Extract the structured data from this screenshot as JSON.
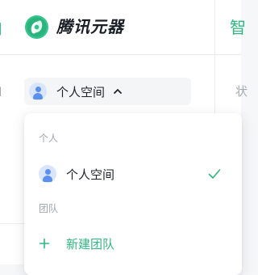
{
  "brand": {
    "name": "腾讯元器",
    "accent_color": "#2fb780",
    "logo_icon": "yuanqi-logo-icon"
  },
  "right_panel": {
    "title_fragment": "智",
    "sub_fragment": "状"
  },
  "workspace_switcher": {
    "current": "个人空间",
    "avatar_icon": "user-avatar-icon",
    "chevron_icon": "chevron-up-icon"
  },
  "dropdown": {
    "personal_section_label": "个人",
    "personal_item_label": "个人空间",
    "personal_item_selected": true,
    "check_icon": "check-icon",
    "team_section_label": "团队",
    "new_team_label": "新建团队",
    "plus_icon": "plus-icon"
  }
}
